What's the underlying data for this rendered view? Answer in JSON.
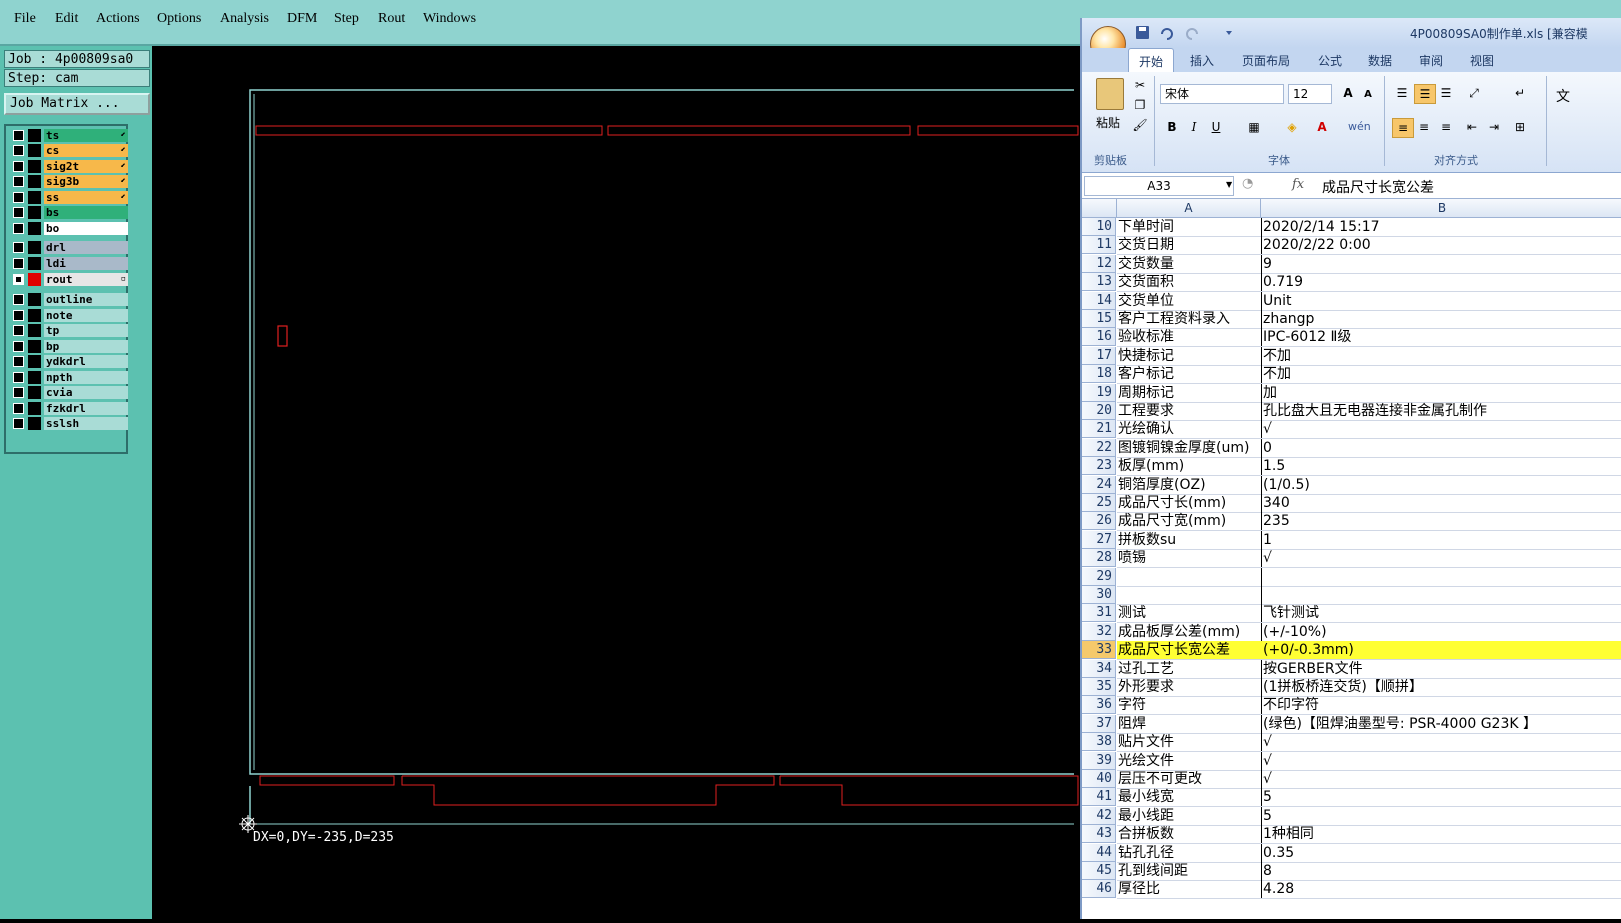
{
  "menu": [
    "File",
    "Edit",
    "Actions",
    "Options",
    "Analysis",
    "DFM",
    "Step",
    "Rout",
    "Windows"
  ],
  "job": {
    "job_label": "Job : 4p00809sa0",
    "step_label": "Step: cam",
    "matrix_button": "Job Matrix ..."
  },
  "layers": [
    {
      "name": "ts",
      "color": "#2fb07a",
      "arrow": "⬋",
      "checked": false
    },
    {
      "name": "cs",
      "color": "#f7b84a",
      "arrow": "⬋",
      "checked": false
    },
    {
      "name": "sig2t",
      "color": "#f7b84a",
      "arrow": "⬋",
      "checked": false
    },
    {
      "name": "sig3b",
      "color": "#f7b84a",
      "arrow": "⬋",
      "checked": false
    },
    {
      "name": "ss",
      "color": "#f7b84a",
      "arrow": "⬋",
      "checked": false
    },
    {
      "name": "bs",
      "color": "#2fb07a",
      "arrow": "",
      "checked": false
    },
    {
      "name": "bo",
      "color": "#ffffff",
      "arrow": "",
      "checked": false
    },
    {
      "name": "drl",
      "color": "#a9b9c9",
      "arrow": "",
      "checked": false
    },
    {
      "name": "ldi",
      "color": "#a9b9c9",
      "arrow": "",
      "checked": false
    },
    {
      "name": "rout",
      "color": "#e6e6e6",
      "arrow": "▫",
      "checked": true
    },
    {
      "name": "outline",
      "color": "#a9dcd6",
      "arrow": "",
      "checked": false
    },
    {
      "name": "note",
      "color": "#a9dcd6",
      "arrow": "",
      "checked": false
    },
    {
      "name": "tp",
      "color": "#a9dcd6",
      "arrow": "",
      "checked": false
    },
    {
      "name": "bp",
      "color": "#a9dcd6",
      "arrow": "",
      "checked": false
    },
    {
      "name": "ydkdrl",
      "color": "#a9dcd6",
      "arrow": "",
      "checked": false
    },
    {
      "name": "npth",
      "color": "#a9dcd6",
      "arrow": "",
      "checked": false
    },
    {
      "name": "cvia",
      "color": "#a9dcd6",
      "arrow": "",
      "checked": false
    },
    {
      "name": "fzkdrl",
      "color": "#a9dcd6",
      "arrow": "",
      "checked": false
    },
    {
      "name": "sslsh",
      "color": "#a9dcd6",
      "arrow": "",
      "checked": false
    }
  ],
  "canvas": {
    "coords": "DX=0,DY=-235,D=235"
  },
  "excel": {
    "title": "4P00809SA0制作单.xls  [兼容模",
    "tabs": [
      "开始",
      "插入",
      "页面布局",
      "公式",
      "数据",
      "审阅",
      "视图"
    ],
    "ribbon": {
      "paste": "粘贴",
      "clipboard": "剪贴板",
      "font_group": "字体",
      "align_group": "对齐方式",
      "font_name": "宋体",
      "font_size": "12",
      "wrap": "文"
    },
    "namebox": "A33",
    "fx": "fx",
    "formula": "成品尺寸长宽公差",
    "col_a": "A",
    "col_b": "B",
    "rows": [
      {
        "n": "10",
        "a": "下单时间",
        "b": "2020/2/14 15:17"
      },
      {
        "n": "11",
        "a": "交货日期",
        "b": "2020/2/22 0:00"
      },
      {
        "n": "12",
        "a": "交货数量",
        "b": "9"
      },
      {
        "n": "13",
        "a": "交货面积",
        "b": "0.719"
      },
      {
        "n": "14",
        "a": "交货单位",
        "b": "Unit"
      },
      {
        "n": "15",
        "a": "客户工程资料录入",
        "b": "zhangp"
      },
      {
        "n": "16",
        "a": "验收标准",
        "b": "IPC-6012 Ⅱ级"
      },
      {
        "n": "17",
        "a": "快捷标记",
        "b": "不加"
      },
      {
        "n": "18",
        "a": "客户标记",
        "b": "不加"
      },
      {
        "n": "19",
        "a": "周期标记",
        "b": "加"
      },
      {
        "n": "20",
        "a": "工程要求",
        "b": "孔比盘大且无电器连接非金属孔制作"
      },
      {
        "n": "21",
        "a": "光绘确认",
        "b": "√"
      },
      {
        "n": "22",
        "a": "图镀铜镍金厚度(um)",
        "b": "0"
      },
      {
        "n": "23",
        "a": "板厚(mm)",
        "b": "1.5"
      },
      {
        "n": "24",
        "a": "铜箔厚度(OZ)",
        "b": "(1/0.5)"
      },
      {
        "n": "25",
        "a": "成品尺寸长(mm)",
        "b": "340"
      },
      {
        "n": "26",
        "a": "成品尺寸宽(mm)",
        "b": "235"
      },
      {
        "n": "27",
        "a": "拼板数su",
        "b": "1"
      },
      {
        "n": "28",
        "a": "喷锡",
        "b": "√"
      },
      {
        "n": "29",
        "a": "",
        "b": ""
      },
      {
        "n": "30",
        "a": "",
        "b": ""
      },
      {
        "n": "31",
        "a": "测试",
        "b": "飞针测试"
      },
      {
        "n": "32",
        "a": "成品板厚公差(mm)",
        "b": "(+/-10%)"
      },
      {
        "n": "33",
        "a": "成品尺寸长宽公差",
        "b": "(+0/-0.3mm)",
        "selected": true
      },
      {
        "n": "34",
        "a": "过孔工艺",
        "b": "按GERBER文件"
      },
      {
        "n": "35",
        "a": "外形要求",
        "b": "(1拼板桥连交货)【顺拼】"
      },
      {
        "n": "36",
        "a": "字符",
        "b": "不印字符"
      },
      {
        "n": "37",
        "a": "阻焊",
        "b": "(绿色)【阻焊油墨型号: PSR-4000 G23K 】"
      },
      {
        "n": "38",
        "a": "贴片文件",
        "b": "√"
      },
      {
        "n": "39",
        "a": "光绘文件",
        "b": "√"
      },
      {
        "n": "40",
        "a": "层压不可更改",
        "b": "√"
      },
      {
        "n": "41",
        "a": "最小线宽",
        "b": "5"
      },
      {
        "n": "42",
        "a": "最小线距",
        "b": "5"
      },
      {
        "n": "43",
        "a": "合拼板数",
        "b": "1种相同"
      },
      {
        "n": "44",
        "a": "钻孔孔径",
        "b": "0.35"
      },
      {
        "n": "45",
        "a": "孔到线间距",
        "b": "8"
      },
      {
        "n": "46",
        "a": "厚径比",
        "b": "4.28"
      }
    ]
  }
}
